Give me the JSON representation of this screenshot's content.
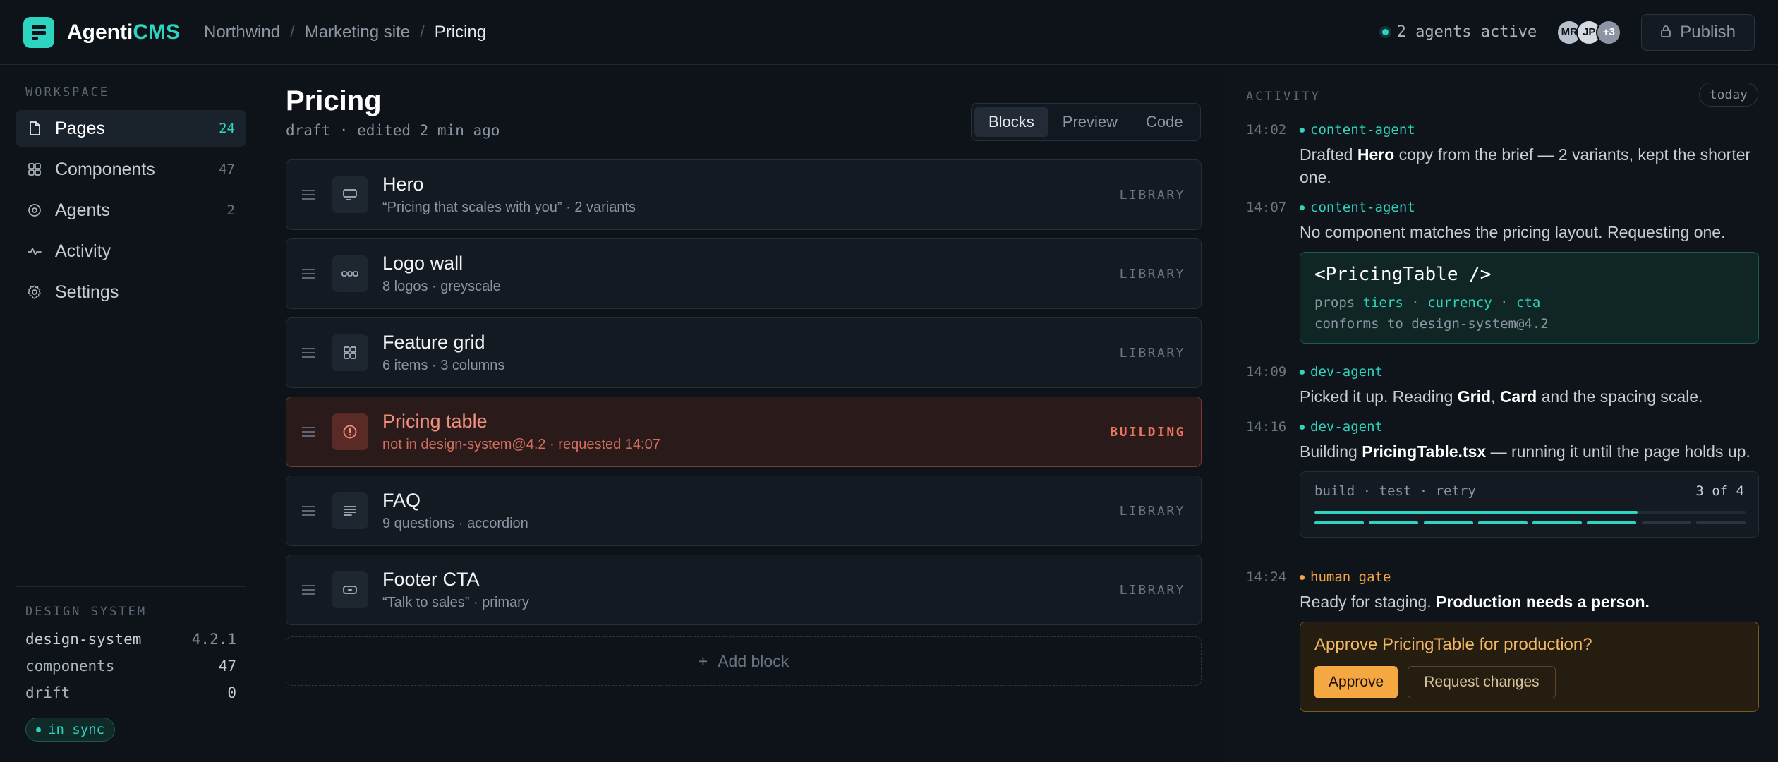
{
  "app": {
    "brand_prefix": "Agenti",
    "brand_accent": "CMS"
  },
  "breadcrumb": [
    "Northwind",
    "Marketing site",
    "Pricing"
  ],
  "header": {
    "agents_active": "2 agents active",
    "avatars": [
      {
        "initials": "MR",
        "color": "#b8c2cc"
      },
      {
        "initials": "JP",
        "color": "#d5dbe1"
      },
      {
        "initials": "+3",
        "color": "#8b95a3"
      }
    ],
    "publish_label": "Publish"
  },
  "sidebar": {
    "section_label": "WORKSPACE",
    "items": [
      {
        "label": "Pages",
        "count": "24",
        "icon": "file-icon",
        "active": true
      },
      {
        "label": "Components",
        "count": "47",
        "icon": "grid-icon"
      },
      {
        "label": "Agents",
        "count": "2",
        "icon": "target-icon"
      },
      {
        "label": "Activity",
        "count": "",
        "icon": "pulse-icon"
      },
      {
        "label": "Settings",
        "count": "",
        "icon": "gear-icon"
      }
    ],
    "design_system": {
      "label": "DESIGN SYSTEM",
      "rows": [
        {
          "key": "design-system",
          "value": "4.2.1"
        },
        {
          "key": "components",
          "value": "47"
        },
        {
          "key": "drift",
          "value": "0"
        }
      ],
      "status": "in sync"
    }
  },
  "main": {
    "title": "Pricing",
    "subtitle": "draft · edited 2 min ago",
    "view_tabs": [
      "Blocks",
      "Preview",
      "Code"
    ],
    "active_tab": "Blocks",
    "blocks": [
      {
        "title": "Hero",
        "sub": "“Pricing that scales with you” · 2 variants",
        "tag": "LIBRARY",
        "icon": "hero-icon"
      },
      {
        "title": "Logo wall",
        "sub": "8 logos · greyscale",
        "tag": "LIBRARY",
        "icon": "logos-icon"
      },
      {
        "title": "Feature grid",
        "sub": "6 items · 3 columns",
        "tag": "LIBRARY",
        "icon": "grid-icon"
      },
      {
        "title": "Pricing table",
        "sub": "not in design-system@4.2 · requested 14:07",
        "tag": "BUILDING",
        "icon": "alert-icon",
        "state": "error"
      },
      {
        "title": "FAQ",
        "sub": "9 questions · accordion",
        "tag": "LIBRARY",
        "icon": "text-lines-icon"
      },
      {
        "title": "Footer CTA",
        "sub": "“Talk to sales” · primary",
        "tag": "LIBRARY",
        "icon": "button-icon"
      }
    ],
    "add_block_label": "Add block"
  },
  "activity": {
    "label": "ACTIVITY",
    "filter": "today",
    "entries": {
      "e1": {
        "time": "14:02",
        "agent": "content-agent",
        "pre": "Drafted ",
        "bold": "Hero",
        "post": " copy from the brief — 2 variants, kept the shorter one."
      },
      "e2": {
        "time": "14:07",
        "agent": "content-agent",
        "text": "No component matches the pricing layout. Requesting one.",
        "card": {
          "name": "<PricingTable />",
          "props_label": "props",
          "props": [
            "tiers",
            "currency",
            "cta"
          ],
          "conforms": "conforms to design-system@4.2"
        }
      },
      "e3": {
        "time": "14:09",
        "agent": "dev-agent",
        "pre": "Picked it up. Reading ",
        "bold1": "Grid",
        "mid": ", ",
        "bold2": "Card",
        "post": " and the spacing scale."
      },
      "e4": {
        "time": "14:16",
        "agent": "dev-agent",
        "pre": "Building ",
        "bold": "PricingTable.tsx",
        "post": " — running it until the page holds up.",
        "build": {
          "label": "build · test · retry",
          "counter": "3 of 4",
          "progress": 0.75,
          "segments_total": 8,
          "segments_done": 6
        }
      },
      "e5": {
        "time": "14:24",
        "agent": "human gate",
        "pre": "Ready for staging. ",
        "bold": "Production needs a person.",
        "approval": {
          "question": "Approve PricingTable for production?",
          "approve": "Approve",
          "changes": "Request changes"
        }
      }
    }
  },
  "colors": {
    "accent": "#2dd4bf",
    "warning": "#f5a742",
    "error": "#e8755f",
    "background": "#0e1319"
  }
}
